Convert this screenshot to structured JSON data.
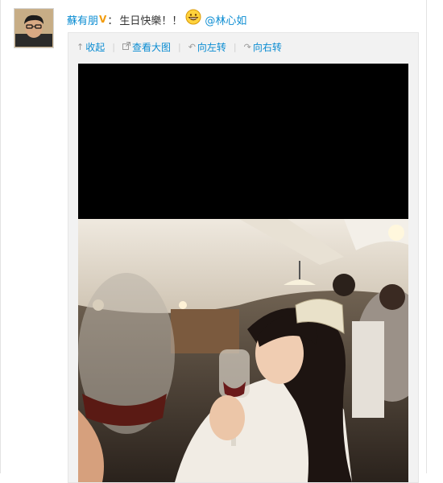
{
  "post": {
    "author": "蘇有朋",
    "verified_badge": "V",
    "colon": "：",
    "text": "生日快樂！！",
    "emoji": "grinning-face-emoji",
    "mention": "@林心如"
  },
  "media_toolbar": {
    "collapse": {
      "label": "收起",
      "icon": "up-arrow-icon"
    },
    "view_large": {
      "label": "查看大图",
      "icon": "enlarge-icon"
    },
    "rotate_left": {
      "label": "向左转",
      "icon": "rotate-left-icon"
    },
    "rotate_right": {
      "label": "向右转",
      "icon": "rotate-right-icon"
    },
    "separator": "|"
  },
  "colors": {
    "link": "#0a8cd2",
    "badge": "#f29b0b",
    "panel_bg": "#f2f2f2"
  }
}
